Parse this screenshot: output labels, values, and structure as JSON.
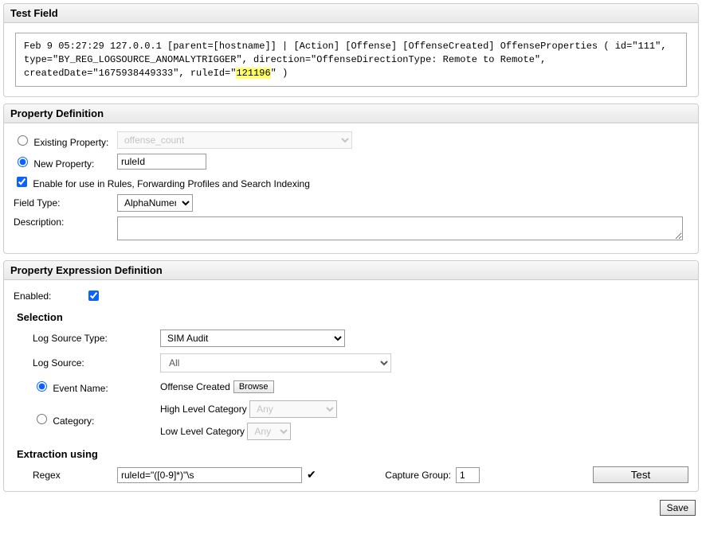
{
  "testField": {
    "title": "Test Field",
    "log_pre": "Feb 9 05:27:29 127.0.0.1 [parent=[hostname]] | [Action] [Offense] [OffenseCreated] OffenseProperties ( id=\"111\", type=\"BY_REG_LOGSOURCE_ANOMALYTRIGGER\", direction=\"OffenseDirectionType: Remote to Remote\", createdDate=\"1675938449333\", ruleId=\"",
    "log_hl": "121196",
    "log_post": "\" )"
  },
  "propDef": {
    "title": "Property Definition",
    "existing_label": "Existing Property:",
    "existing_value": "offense_count",
    "new_label": "New Property:",
    "new_value": "ruleId",
    "enable_label": "Enable for use in Rules, Forwarding Profiles and Search Indexing",
    "fieldtype_label": "Field Type:",
    "fieldtype_value": "AlphaNumeric",
    "desc_label": "Description:",
    "desc_value": ""
  },
  "exprDef": {
    "title": "Property Expression Definition",
    "enabled_label": "Enabled:",
    "selection_header": "Selection",
    "lst_label": "Log Source Type:",
    "lst_value": "SIM Audit",
    "ls_label": "Log Source:",
    "ls_value": "All",
    "eventname_label": "Event Name:",
    "eventname_value": "Offense Created",
    "browse_label": "Browse",
    "category_label": "Category:",
    "hlc_label": "High Level Category",
    "hlc_value": "Any",
    "llc_label": "Low Level Category",
    "llc_value": "Any",
    "extract_header": "Extraction using",
    "regex_label": "Regex",
    "regex_value": "ruleId=\"([0-9]*)\"\\s",
    "check_symbol": "✔",
    "cg_label": "Capture Group:",
    "cg_value": "1",
    "test_label": "Test"
  },
  "save_label": "Save"
}
